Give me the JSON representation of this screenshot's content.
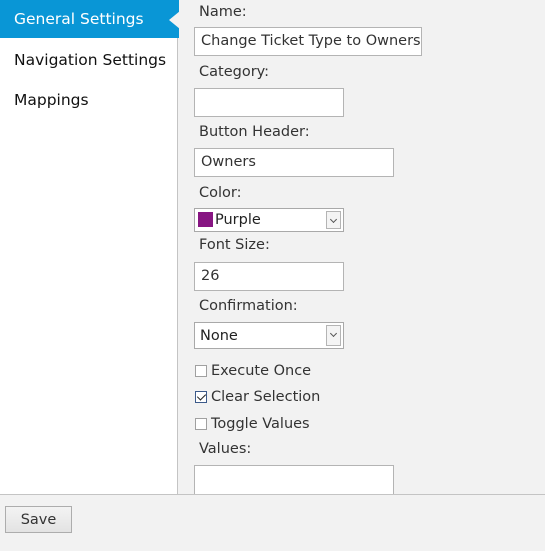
{
  "sidebar": {
    "items": [
      {
        "label": "General Settings",
        "active": true
      },
      {
        "label": "Navigation Settings",
        "active": false
      },
      {
        "label": "Mappings",
        "active": false
      }
    ]
  },
  "form": {
    "name": {
      "label": "Name:",
      "value": "Change Ticket Type to Owners"
    },
    "category": {
      "label": "Category:",
      "value": ""
    },
    "button_header": {
      "label": "Button Header:",
      "value": "Owners"
    },
    "color": {
      "label": "Color:",
      "selected": "Purple",
      "swatch": "#871582"
    },
    "font_size": {
      "label": "Font Size:",
      "value": "26"
    },
    "confirmation": {
      "label": "Confirmation:",
      "selected": "None"
    },
    "execute_once": {
      "label": "Execute Once",
      "checked": false
    },
    "clear_selection": {
      "label": "Clear Selection",
      "checked": true
    },
    "toggle_values": {
      "label": "Toggle Values",
      "checked": false
    },
    "values": {
      "label": "Values:",
      "value": ""
    }
  },
  "footer": {
    "save_label": "Save"
  },
  "colors": {
    "accent": "#0996d6",
    "panel_bg": "#f2f2f2"
  }
}
